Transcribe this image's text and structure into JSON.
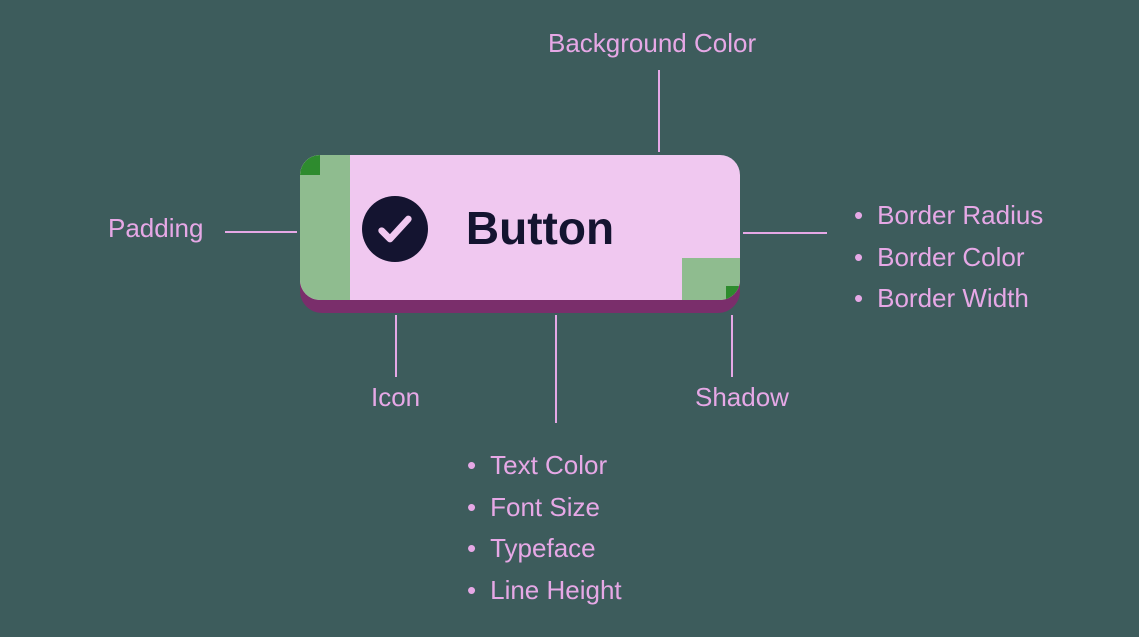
{
  "annotations": {
    "background": "Background Color",
    "padding": "Padding",
    "icon": "Icon",
    "shadow": "Shadow",
    "border": {
      "radius": "Border Radius",
      "color": "Border Color",
      "width": "Border Width"
    },
    "text": {
      "color": "Text Color",
      "fontSize": "Font Size",
      "typeface": "Typeface",
      "lineHeight": "Line Height"
    }
  },
  "button": {
    "label": "Button"
  }
}
